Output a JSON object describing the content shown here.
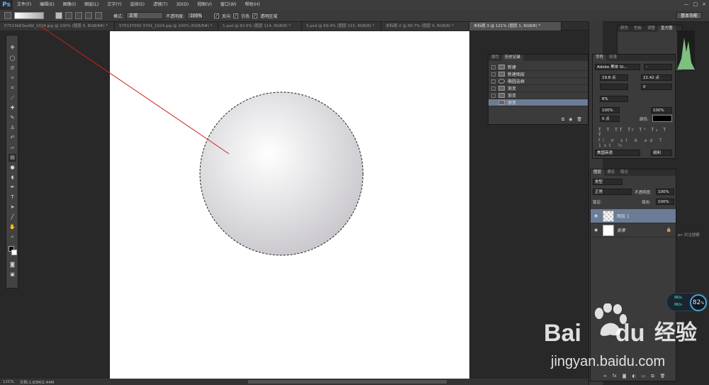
{
  "app": {
    "logo": "Ps",
    "menu": [
      "文件(F)",
      "编辑(E)",
      "图像(I)",
      "图层(L)",
      "文字(Y)",
      "选择(S)",
      "滤镜(T)",
      "3D(D)",
      "视图(V)",
      "窗口(W)",
      "帮助(H)"
    ],
    "window_controls": [
      "—",
      "□",
      "×"
    ]
  },
  "options_bar": {
    "mode_label": "模式:",
    "mode_value": "正常",
    "opacity_label": "不透明度:",
    "opacity_value": "100%",
    "reverse_label": "反向",
    "dither_label": "仿色",
    "transparency_label": "透明区域",
    "workspace": "基本功能"
  },
  "tabs": [
    {
      "label": "57513b63eefbf_1024.jpg @ 100% (图层 0, RGB/8#) *",
      "active": false
    },
    {
      "label": "575137050 3741_1024.jpg @ 100% (RGB/8#) *",
      "active": false
    },
    {
      "label": "1.psd @ 82.6% (图层 114, RGB/8) *",
      "active": false
    },
    {
      "label": "5.psd @ 69.4% (图层 115, RGB/8) *",
      "active": false
    },
    {
      "label": "未标题-2 @ 66.7% (图层 9, RGB/8) *",
      "active": false
    },
    {
      "label": "未标题-3 @ 121% (图层 1, RGB/8) *",
      "active": true
    }
  ],
  "history_panel": {
    "tabs": [
      "属性",
      "历史记录"
    ],
    "items": [
      {
        "label": "新建",
        "selected": false
      },
      {
        "label": "新建图层",
        "selected": false
      },
      {
        "label": "椭圆选框",
        "selected": false
      },
      {
        "label": "渐变",
        "selected": false
      },
      {
        "label": "渐变",
        "selected": false
      },
      {
        "label": "渐变",
        "selected": true
      }
    ]
  },
  "character_panel": {
    "tabs": [
      "字符",
      "段落"
    ],
    "font": "Adobe 黑体 St...",
    "size": "19.8 点",
    "leading": "22.42 点",
    "tracking": "0",
    "scale": "6%",
    "vscale": "100%",
    "hscale": "100%",
    "baseline": "0 点",
    "color_label": "颜色:",
    "language": "美国英语",
    "aa": "锐利"
  },
  "color_panel": {
    "tabs": [
      "颜色",
      "色板",
      "调整",
      "直方图"
    ]
  },
  "layers_panel": {
    "tabs": [
      "图层",
      "通道",
      "路径"
    ],
    "filter": "类型",
    "blend": "正常",
    "opacity_label": "不透明度:",
    "opacity": "100%",
    "lock_label": "锁定:",
    "fill_label": "填充:",
    "fill": "100%",
    "layers": [
      {
        "name": "图层 1",
        "selected": true
      },
      {
        "name": "背景",
        "selected": false
      }
    ]
  },
  "status": {
    "zoom": "121%",
    "doc": "文档:1.83M/2.44M"
  },
  "network_widget": {
    "up": "0K/s",
    "down": "0K/s",
    "percent": "82",
    "percent_sign": "%"
  },
  "watermark": {
    "brand": "Bai",
    "brand_suffix": "du",
    "cn": "经验",
    "url": "jingyan.baidu.com"
  },
  "side_text": "en 对注提硬",
  "colors": {
    "ui_dark": "#282828",
    "panel": "#3b3b3b",
    "selected": "#6b7c96",
    "guide": "#cc2222"
  }
}
